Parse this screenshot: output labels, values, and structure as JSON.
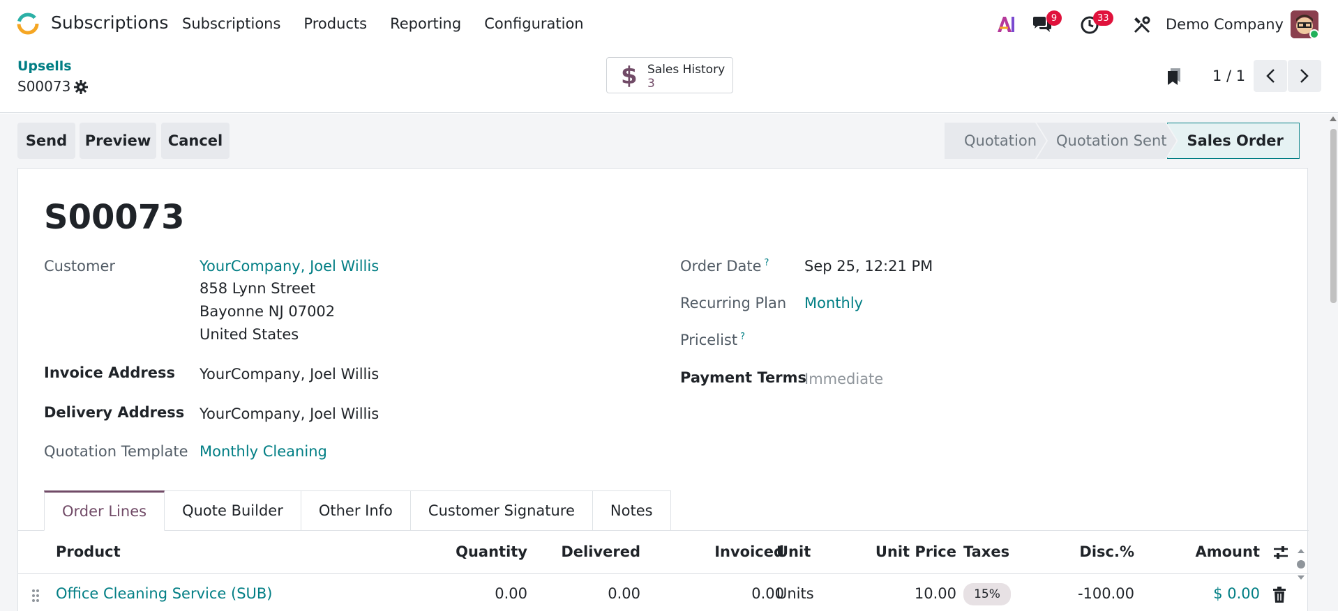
{
  "navbar": {
    "app_title": "Subscriptions",
    "menu": [
      "Subscriptions",
      "Products",
      "Reporting",
      "Configuration"
    ],
    "ai_label": "AI",
    "messages_count": "9",
    "activities_count": "33",
    "company": "Demo Company"
  },
  "control_panel": {
    "breadcrumb": "Upsells",
    "record_name": "S00073",
    "smart_button": {
      "label": "Sales History",
      "value": "3"
    },
    "pager": "1 / 1"
  },
  "status_bar": {
    "buttons": {
      "send": "Send",
      "preview": "Preview",
      "cancel": "Cancel"
    },
    "stages": [
      "Quotation",
      "Quotation Sent",
      "Sales Order"
    ],
    "active_stage": "Sales Order"
  },
  "form": {
    "title": "S00073",
    "customer_label": "Customer",
    "customer_name": "YourCompany, Joel Willis",
    "customer_street": "858 Lynn Street",
    "customer_city": "Bayonne NJ 07002",
    "customer_country": "United States",
    "invoice_address_label": "Invoice Address",
    "invoice_address": "YourCompany, Joel Willis",
    "delivery_address_label": "Delivery Address",
    "delivery_address": "YourCompany, Joel Willis",
    "quotation_template_label": "Quotation Template",
    "quotation_template": "Monthly Cleaning",
    "order_date_label": "Order Date",
    "order_date": "Sep 25, 12:21 PM",
    "recurring_plan_label": "Recurring Plan",
    "recurring_plan": "Monthly",
    "pricelist_label": "Pricelist",
    "payment_terms_label": "Payment Terms",
    "payment_terms": "Immediate",
    "help_mark": "?"
  },
  "tabs": [
    "Order Lines",
    "Quote Builder",
    "Other Info",
    "Customer Signature",
    "Notes"
  ],
  "active_tab": "Order Lines",
  "order_lines": {
    "columns": [
      "Product",
      "Quantity",
      "Delivered",
      "Invoiced",
      "Unit",
      "Unit Price",
      "Taxes",
      "Disc.%",
      "Amount"
    ],
    "rows": [
      {
        "product": "Office Cleaning Service (SUB)",
        "quantity": "0.00",
        "delivered": "0.00",
        "invoiced": "0.00",
        "unit": "Units",
        "unit_price": "10.00",
        "taxes": "15%",
        "discount": "-100.00",
        "amount": "$ 0.00"
      }
    ]
  },
  "colors": {
    "brand": "#714b67",
    "link": "#017e84",
    "badge": "#e0123c"
  },
  "icons": [
    "ai-icon",
    "chat-icon",
    "clock-icon",
    "tools-icon",
    "gear-icon",
    "dollar-icon",
    "bookmark-icon",
    "chevron-left-icon",
    "chevron-right-icon",
    "drag-handle-icon",
    "trash-icon",
    "optional-columns-icon"
  ]
}
